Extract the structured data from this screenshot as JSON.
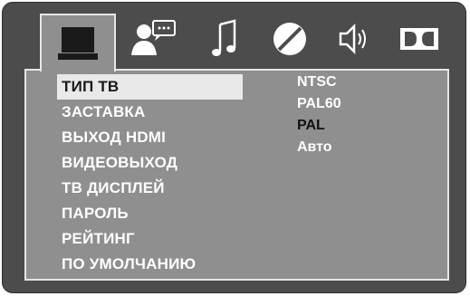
{
  "tabs": [
    {
      "id": "tv-setup",
      "icon": "tv-monitor-icon",
      "active": true
    },
    {
      "id": "language",
      "icon": "speaker-person-subtitle-icon",
      "active": false
    },
    {
      "id": "audio",
      "icon": "music-note-icon",
      "active": false
    },
    {
      "id": "disc",
      "icon": "disc-icon",
      "active": false
    },
    {
      "id": "speaker",
      "icon": "speaker-volume-icon",
      "active": false
    },
    {
      "id": "dolby",
      "icon": "dolby-icon",
      "active": false
    }
  ],
  "menu": {
    "items": [
      {
        "label": "ТИП ТВ",
        "selected": true
      },
      {
        "label": "ЗАСТАВКА",
        "selected": false
      },
      {
        "label": "ВЫХОД HDMI",
        "selected": false
      },
      {
        "label": "ВИДЕОВЫХОД",
        "selected": false
      },
      {
        "label": "ТВ ДИСПЛЕЙ",
        "selected": false
      },
      {
        "label": "ПАРОЛЬ",
        "selected": false
      },
      {
        "label": "РЕЙТИНГ",
        "selected": false
      },
      {
        "label": "ПО УМОЛЧАНИЮ",
        "selected": false
      }
    ]
  },
  "options": {
    "items": [
      {
        "label": "NTSC",
        "current": false
      },
      {
        "label": "PAL60",
        "current": false
      },
      {
        "label": "PAL",
        "current": true
      },
      {
        "label": "Авто",
        "current": false
      }
    ]
  },
  "colors": {
    "frame": "#4c4c4c",
    "panel": "#8f8f8f",
    "border": "#e6e6e6",
    "selection": "#e9e9e9",
    "text": "#ffffff"
  }
}
